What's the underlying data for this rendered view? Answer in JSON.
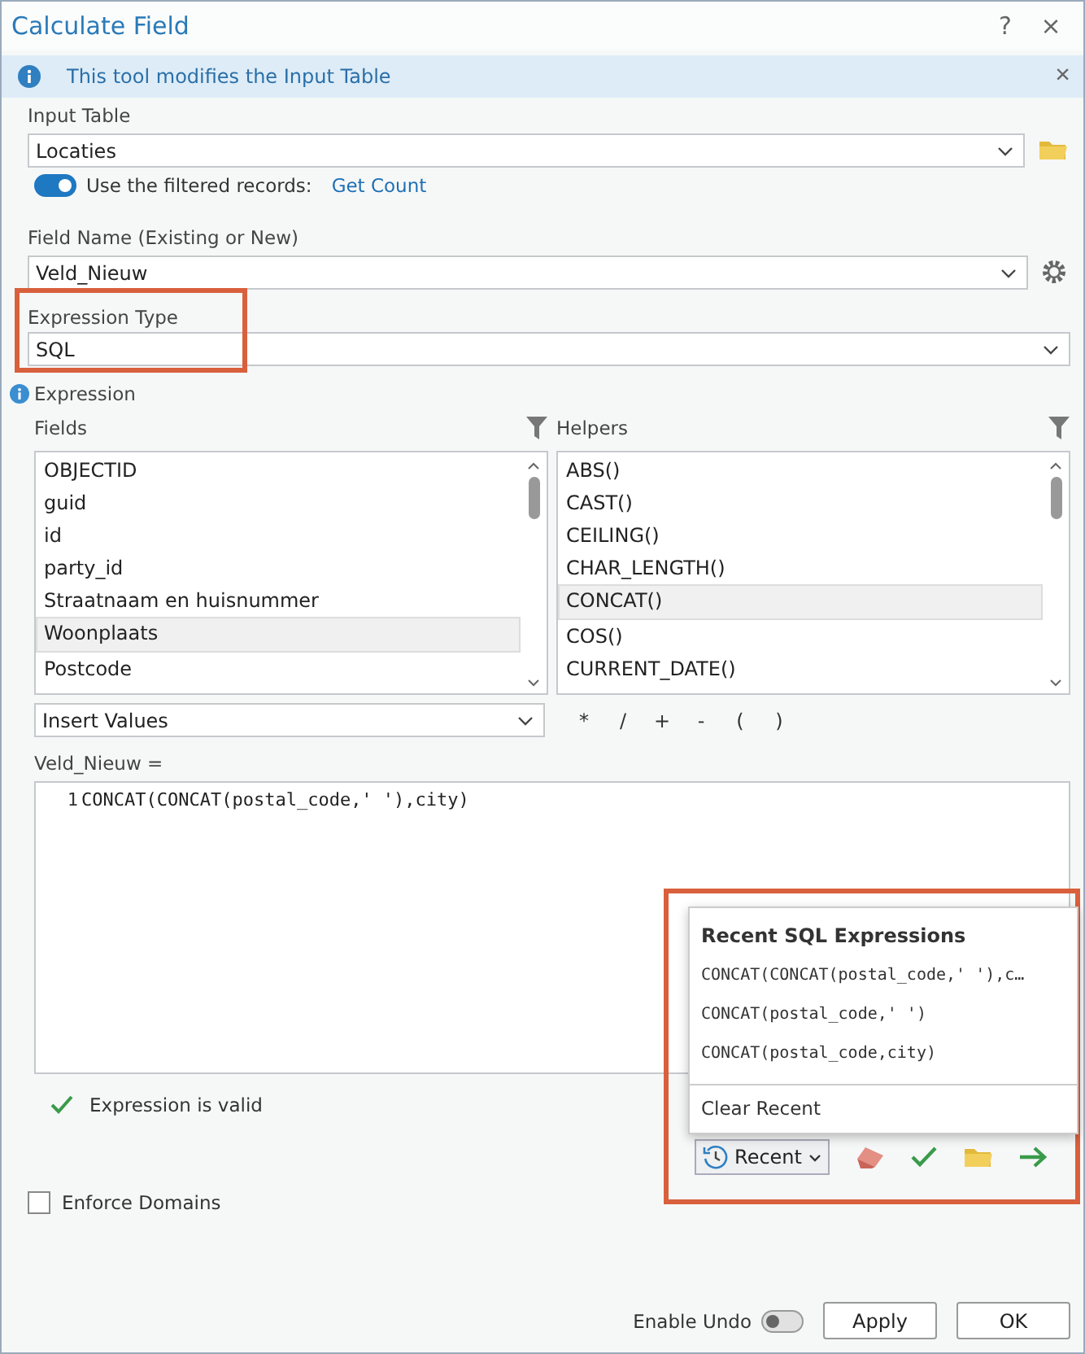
{
  "window": {
    "title": "Calculate Field",
    "help": "?",
    "close": "×"
  },
  "info_bar": {
    "message": "This tool modifies the Input Table",
    "close": "×"
  },
  "input_table": {
    "label": "Input Table",
    "value": "Locaties"
  },
  "filtered_records": {
    "label": "Use the filtered records:",
    "on": true,
    "link": "Get Count"
  },
  "field_name": {
    "label": "Field Name (Existing or New)",
    "value": "Veld_Nieuw"
  },
  "expression_type": {
    "label": "Expression Type",
    "value": "SQL",
    "highlighted": true
  },
  "expression": {
    "label": "Expression"
  },
  "fields": {
    "label": "Fields",
    "items": [
      {
        "text": "OBJECTID",
        "selected": false
      },
      {
        "text": "guid",
        "selected": false
      },
      {
        "text": "id",
        "selected": false
      },
      {
        "text": "party_id",
        "selected": false
      },
      {
        "text": "Straatnaam en huisnummer",
        "selected": false
      },
      {
        "text": "Woonplaats",
        "selected": true
      },
      {
        "text": "Postcode",
        "selected": false
      }
    ]
  },
  "helpers": {
    "label": "Helpers",
    "items": [
      {
        "text": "ABS()",
        "selected": false
      },
      {
        "text": "CAST()",
        "selected": false
      },
      {
        "text": "CEILING()",
        "selected": false
      },
      {
        "text": "CHAR_LENGTH()",
        "selected": false
      },
      {
        "text": "CONCAT()",
        "selected": true
      },
      {
        "text": "COS()",
        "selected": false
      },
      {
        "text": "CURRENT_DATE()",
        "selected": false
      }
    ]
  },
  "insert_values": {
    "value": "Insert Values"
  },
  "operators": [
    "*",
    "/",
    "+",
    "-",
    "(",
    ")"
  ],
  "editor": {
    "label": "Veld_Nieuw =",
    "lines": [
      {
        "number": "1",
        "code": "CONCAT(CONCAT(postal_code,' '),city)"
      }
    ]
  },
  "validation": {
    "message": "Expression is valid",
    "valid": true
  },
  "recent_menu": {
    "title": "Recent SQL Expressions",
    "items": [
      "CONCAT(CONCAT(postal_code,' '),c…",
      "CONCAT(postal_code,' ')",
      "CONCAT(postal_code,city)"
    ],
    "clear": "Clear Recent",
    "highlighted": true
  },
  "recent_button": {
    "label": "Recent"
  },
  "enforce_domains": {
    "label": "Enforce Domains",
    "checked": false
  },
  "enable_undo": {
    "label": "Enable Undo",
    "on": false
  },
  "buttons": [
    "Apply",
    "OK"
  ]
}
